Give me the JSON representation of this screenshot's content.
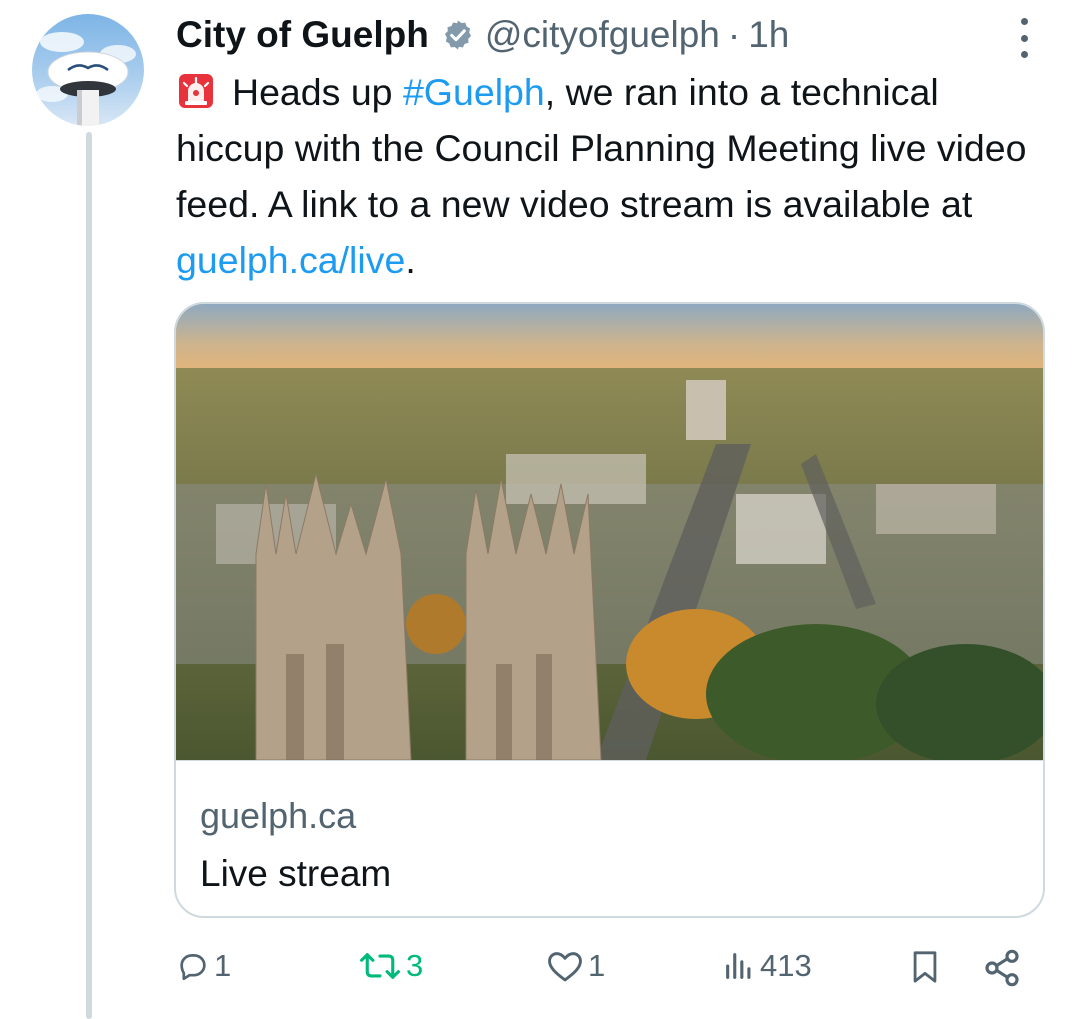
{
  "tweet": {
    "author_name": "City of Guelph",
    "handle": "@cityofguelph",
    "separator": "·",
    "time": "1h",
    "text_parts": {
      "intro": "Heads up ",
      "hashtag": "#Guelph",
      "middle": ", we ran into a technical hiccup with the Council Planning Meeting live video feed. A link to a new video stream is available at ",
      "link": "guelph.ca/live",
      "end": "."
    }
  },
  "card": {
    "domain": "guelph.ca",
    "title": "Live stream"
  },
  "actions": {
    "replies": "1",
    "retweets": "3",
    "likes": "1",
    "views": "413"
  },
  "colors": {
    "link": "#1d9bf0",
    "retweet_active": "#00ba7c",
    "secondary_text": "#536471"
  },
  "icons": [
    "verified-badge-icon",
    "more-options-icon",
    "alarm-emoji-icon",
    "reply-icon",
    "retweet-icon",
    "like-icon",
    "views-icon",
    "bookmark-icon",
    "share-icon"
  ]
}
